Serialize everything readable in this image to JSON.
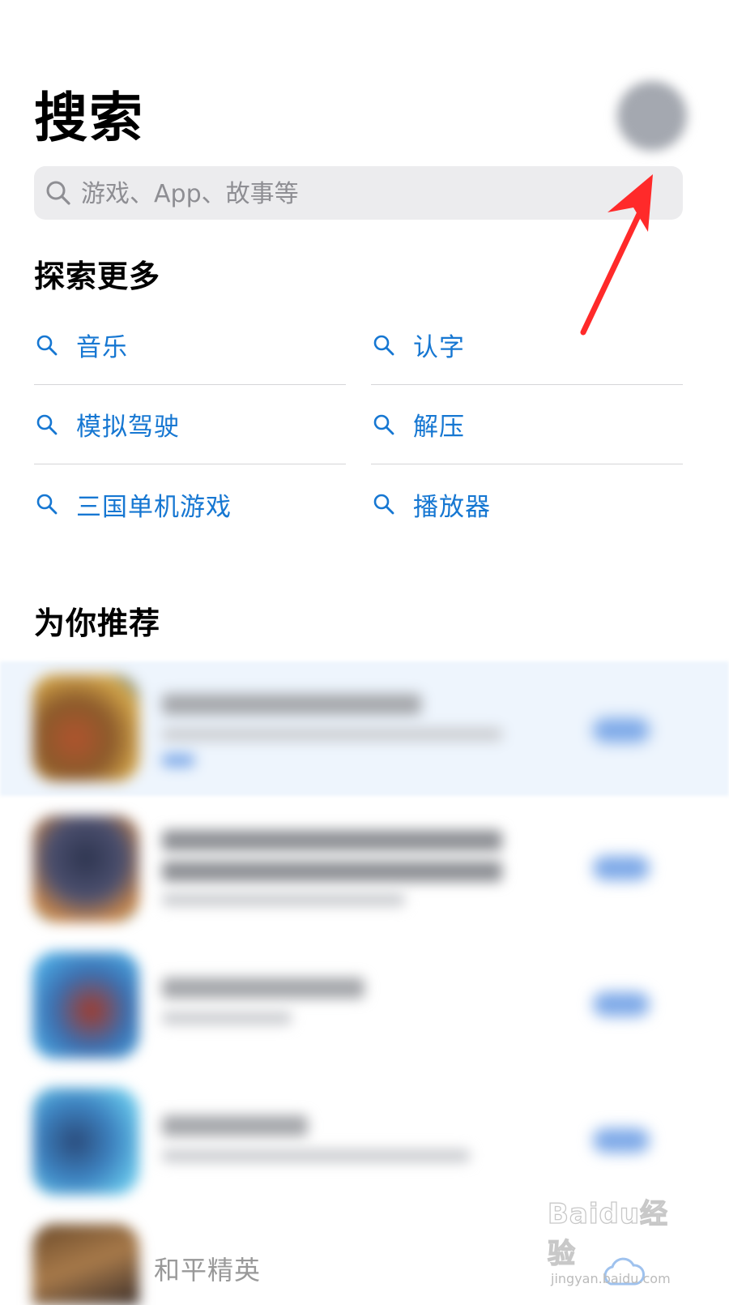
{
  "header": {
    "title": "搜索"
  },
  "search": {
    "placeholder": "游戏、App、故事等"
  },
  "explore": {
    "title": "探索更多",
    "items": [
      {
        "label": "音乐"
      },
      {
        "label": "认字"
      },
      {
        "label": "模拟驾驶"
      },
      {
        "label": "解压"
      },
      {
        "label": "三国单机游戏"
      },
      {
        "label": "播放器"
      }
    ]
  },
  "recommend": {
    "title": "为你推荐",
    "last_app_name": "和平精英"
  },
  "watermark": {
    "logo": "Baidu经验",
    "sub": "jingyan.baidu.com"
  },
  "colors": {
    "link": "#1677d2",
    "annotation_arrow": "#ff2a2a",
    "search_bg": "#ececee"
  },
  "icons": {
    "search": "search-icon",
    "avatar": "account-avatar",
    "download": "cloud-download-icon"
  }
}
